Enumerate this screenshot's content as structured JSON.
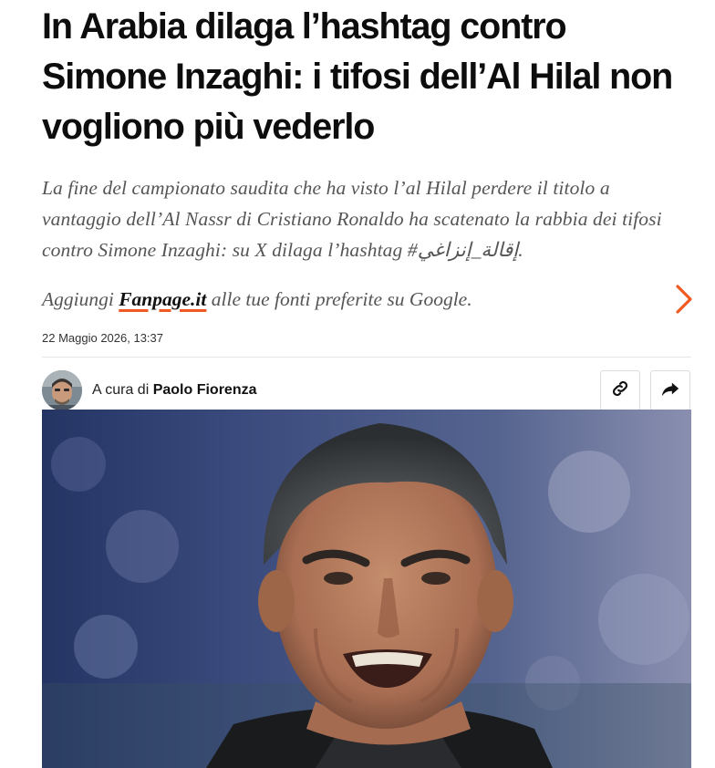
{
  "article": {
    "headline": "In Arabia dilaga l’hashtag contro Simone Inzaghi: i tifosi dell’Al Hilal non vogliono più vederlo",
    "subtitle": "La fine del campionato saudita che ha visto l’al Hilal perdere il titolo a vantaggio dell’Al Nassr di Cristiano Ronaldo ha scatenato la rabbia dei tifosi contro Simone Inzaghi: su X dilaga l’hashtag #إقالة_إنزاغي.",
    "date": "22 Maggio 2026, 13:37"
  },
  "promo": {
    "prefix": "Aggiungi ",
    "brand": "Fanpage.it",
    "suffix": " alle tue fonti preferite su Google.",
    "icon": "chevron-right-icon",
    "accent_color": "#f05a22"
  },
  "author": {
    "prefix": "A cura di ",
    "name": "Paolo Fiorenza"
  },
  "actions": {
    "copy_link_icon": "link-icon",
    "share_icon": "share-icon"
  },
  "colors": {
    "headline": "#0d0d0d",
    "subtitle": "#555555",
    "divider": "#e6e6e6",
    "accent": "#f05a22"
  }
}
